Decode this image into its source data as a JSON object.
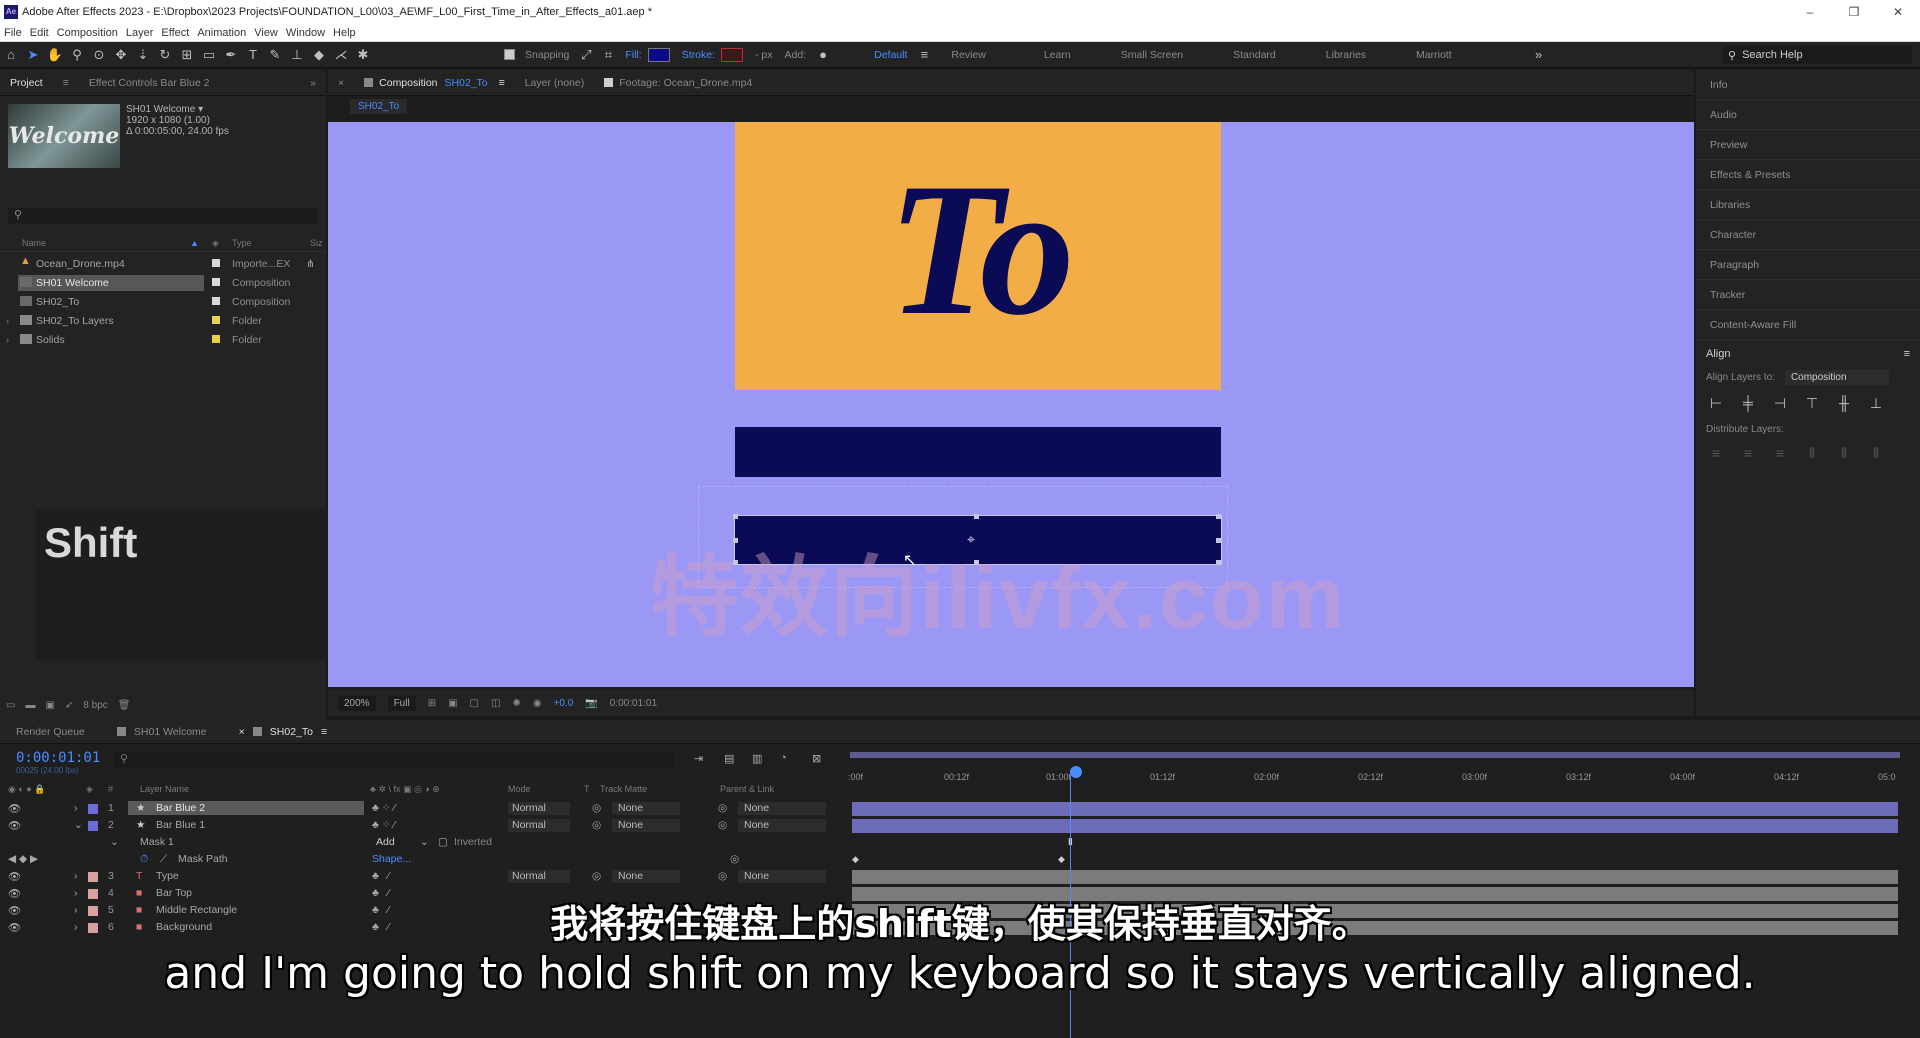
{
  "window": {
    "title": "Adobe After Effects 2023 - E:\\Dropbox\\2023 Projects\\FOUNDATION_L00\\03_AE\\MF_L00_First_Time_in_After_Effects_a01.aep *",
    "controls": [
      "–",
      "❐",
      "✕"
    ]
  },
  "menu": [
    "File",
    "Edit",
    "Composition",
    "Layer",
    "Effect",
    "Animation",
    "View",
    "Window",
    "Help"
  ],
  "toolbar": {
    "snapping": "Snapping",
    "fill": "Fill:",
    "stroke": "Stroke:",
    "px": "- px",
    "add": "Add:",
    "workspaces": [
      "Default",
      "Review",
      "Learn",
      "Small Screen",
      "Standard",
      "Libraries",
      "Marriott"
    ],
    "search_help": "Search Help",
    "fill_color": "#0b0a8a",
    "stroke_color": "#c03030"
  },
  "project": {
    "tab": "Project",
    "effect_tab": "Effect Controls Bar Blue 2",
    "thumb_text": "Welcome",
    "selected_name": "SH01 Welcome ▾",
    "selected_res": "1920 x 1080 (1.00)",
    "selected_dur": "Δ 0:00:05:00, 24.00 fps",
    "col_name": "Name",
    "col_type": "Type",
    "col_size": "Siz",
    "items": [
      {
        "name": "Ocean_Drone.mp4",
        "type": "Importe...EX",
        "label": "#d8d8d8"
      },
      {
        "name": "SH01 Welcome",
        "type": "Composition",
        "label": "#d8d8d8"
      },
      {
        "name": "SH02_To",
        "type": "Composition",
        "label": "#d8d8d8"
      },
      {
        "name": "SH02_To Layers",
        "type": "Folder",
        "label": "#e5d04a"
      },
      {
        "name": "Solids",
        "type": "Folder",
        "label": "#e5d04a"
      }
    ],
    "bpc": "8 bpc"
  },
  "shift_overlay": "Shift",
  "viewer": {
    "comp_tab": "Composition",
    "comp_name": "SH02_To",
    "layer_tab": "Layer (none)",
    "footage_tab": "Footage: Ocean_Drone.mp4",
    "breadcrumb": "SH02_To",
    "word": "To",
    "watermark": "特效向ilivfx.com",
    "zoom": "200%",
    "resolution": "Full",
    "exposure": "+0.0",
    "time": "0:00:01:01",
    "bg_color": "#9b98f5",
    "card_color": "#f3ad47",
    "bar_color": "#0b0a55"
  },
  "right_panel": {
    "items": [
      "Info",
      "Audio",
      "Preview",
      "Effects & Presets",
      "Libraries",
      "Character",
      "Paragraph",
      "Tracker",
      "Content-Aware Fill"
    ],
    "align": "Align",
    "align_to_label": "Align Layers to:",
    "align_to_value": "Composition",
    "distribute": "Distribute Layers:"
  },
  "timeline": {
    "tabs": [
      "Render Queue",
      "SH01 Welcome",
      "SH02_To"
    ],
    "timecode": "0:00:01:01",
    "timecode_sub": "00025 (24.00 fps)",
    "headers": {
      "layer_name": "Layer Name",
      "mode": "Mode",
      "t": "T",
      "track_matte": "Track Matte",
      "parent": "Parent & Link"
    },
    "ruler": [
      ":00f",
      "00:12f",
      "01:00f",
      "01:12f",
      "02:00f",
      "02:12f",
      "03:00f",
      "03:12f",
      "04:00f",
      "04:12f",
      "05:0"
    ],
    "layers": [
      {
        "num": "1",
        "name": "Bar Blue 2",
        "mode": "Normal",
        "matte": "None",
        "parent": "None",
        "label": "#6c6cd8",
        "icon": "★"
      },
      {
        "num": "2",
        "name": "Bar Blue 1",
        "mode": "Normal",
        "matte": "None",
        "parent": "None",
        "label": "#6c6cd8",
        "icon": "★"
      },
      {
        "num": "3",
        "name": "Type",
        "mode": "Normal",
        "matte": "None",
        "parent": "None",
        "label": "#d9a0a0",
        "icon": "T"
      },
      {
        "num": "4",
        "name": "Bar Top",
        "label": "#d9a0a0",
        "icon": "■"
      },
      {
        "num": "5",
        "name": "Middle Rectangle",
        "label": "#d9a0a0",
        "icon": "■"
      },
      {
        "num": "6",
        "name": "Background",
        "label": "#d9a0a0",
        "icon": "■"
      }
    ],
    "mask": {
      "name": "Mask 1",
      "mode": "Add",
      "inverted": "Inverted",
      "path": "Mask Path",
      "path_value": "Shape..."
    }
  },
  "subtitles": {
    "cn": "我将按住键盘上的shift键，使其保持垂直对齐。",
    "en": "and I'm going to hold shift on my keyboard so it stays vertically aligned."
  }
}
